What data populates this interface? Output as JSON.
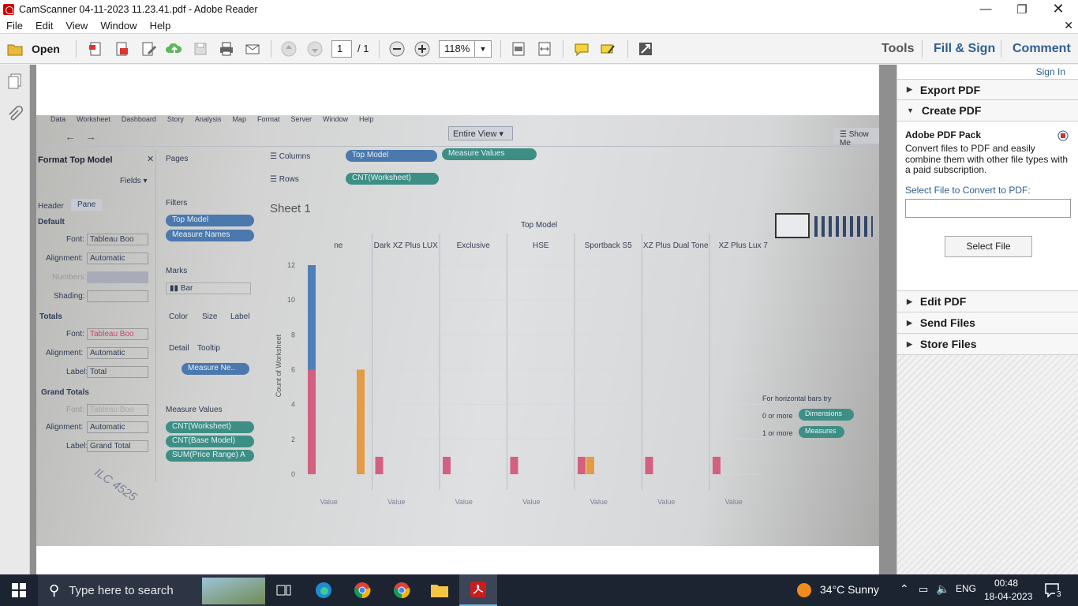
{
  "window": {
    "title": "CamScanner 04-11-2023 11.23.41.pdf - Adobe Reader"
  },
  "menu": [
    "File",
    "Edit",
    "View",
    "Window",
    "Help"
  ],
  "toolbar": {
    "open_label": "Open",
    "page_current": "1",
    "page_total": "/ 1",
    "zoom": "118%",
    "tools": "Tools",
    "fill_sign": "Fill & Sign",
    "comment": "Comment"
  },
  "sidepanel": {
    "sign_in": "Sign In",
    "export_pdf": "Export PDF",
    "create_pdf": "Create PDF",
    "pack_title": "Adobe PDF Pack",
    "pack_desc": "Convert files to PDF and easily combine them with other file types with a paid subscription.",
    "select_label": "Select File to Convert to PDF:",
    "select_button": "Select File",
    "edit_pdf": "Edit PDF",
    "send_files": "Send Files",
    "store_files": "Store Files"
  },
  "photo": {
    "menu": [
      "Data",
      "Worksheet",
      "Dashboard",
      "Story",
      "Analysis",
      "Map",
      "Format",
      "Server",
      "Window",
      "Help"
    ],
    "entire_view": "Entire View",
    "show_me": "Show Me",
    "format_title": "Format Top Model",
    "fields": "Fields",
    "tab_header": "Header",
    "tab_pane": "Pane",
    "default": "Default",
    "font_lbl": "Font:",
    "font_val": "Tableau Boo",
    "alignment_lbl": "Alignment:",
    "alignment_val": "Automatic",
    "numbers_lbl": "Numbers:",
    "shading_lbl": "Shading:",
    "totals": "Totals",
    "label_lbl": "Label:",
    "total_val": "Total",
    "grand_totals": "Grand Totals",
    "grand_total_val": "Grand Total",
    "pages": "Pages",
    "filters": "Filters",
    "filter_top_model": "Top Model",
    "filter_measure_names": "Measure Names",
    "marks": "Marks",
    "marks_type": "Bar",
    "mark_color": "Color",
    "mark_size": "Size",
    "mark_label": "Label",
    "mark_detail": "Detail",
    "mark_tooltip": "Tooltip",
    "measure_ne": "Measure Ne..",
    "measure_values": "Measure Values",
    "mv_items": [
      "CNT(Worksheet)",
      "CNT(Base Model)",
      "SUM(Price Range) A"
    ],
    "columns": "Columns",
    "rows": "Rows",
    "col_pill_1": "Top Model",
    "col_pill_2": "Measure Values",
    "row_pill": "CNT(Worksheet)",
    "sheet_title": "Sheet 1",
    "top_model_header": "Top Model",
    "hint_1": "For horizontal bars try",
    "hint_2": "0 or more",
    "hint_3": "Dimensions",
    "hint_4": "1 or more",
    "hint_5": "Measures",
    "handwriting": "ILC 4525"
  },
  "chart_data": {
    "type": "bar",
    "title": "Sheet 1",
    "xlabel": "Top Model",
    "ylabel": "Count of Worksheet",
    "categories": [
      "ne",
      "Dark XZ Plus LUX",
      "Exclusive",
      "HSE",
      "Sportback S5",
      "XZ Plus Dual Tone",
      "XZ Plus Lux 7"
    ],
    "y_ticks": [
      "12",
      "10",
      "8",
      "6",
      "4",
      "2",
      "0"
    ],
    "bottom_labels": [
      "Value",
      "Value",
      "Value",
      "Value",
      "Value",
      "Value",
      "Value"
    ],
    "ylim": [
      0,
      12
    ],
    "series": [
      {
        "name": "CNT(Worksheet)",
        "color": "#4f7fb8",
        "values": [
          12,
          1,
          1,
          1,
          1,
          1,
          1
        ]
      },
      {
        "name": "CNT(Base Model)",
        "color": "#d36080",
        "values": [
          6,
          1,
          1,
          1,
          1,
          1,
          1
        ]
      },
      {
        "name": "SUM(Price Range) A",
        "color": "#e39b45",
        "values": [
          6,
          0,
          0,
          0,
          1,
          0,
          0
        ]
      }
    ]
  },
  "taskbar": {
    "search_placeholder": "Type here to search",
    "weather": "34°C  Sunny",
    "lang": "ENG",
    "time": "00:48",
    "date": "18-04-2023",
    "notif_count": "3"
  }
}
